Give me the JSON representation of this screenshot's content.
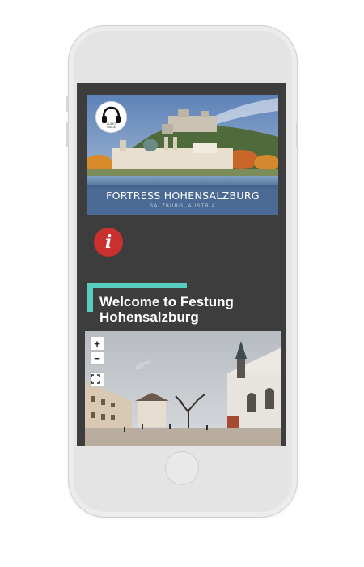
{
  "hero": {
    "title": "FORTRESS HOHENSALZBURG",
    "subtitle": "SALZBURG, AUSTRIA",
    "badge_label": "AUDIO\nGUIDE"
  },
  "welcome_heading": "Welcome to Festung Hohensalzburg",
  "viewer": {
    "zoom_in_label": "+",
    "zoom_out_label": "−",
    "watermark": "allmi"
  },
  "icons": {
    "info": "info-icon",
    "audio": "headphones-icon",
    "fullscreen": "fullscreen-icon"
  },
  "colors": {
    "screen_bg": "#3d3d3d",
    "accent": "#59ccc0",
    "info": "#c8312d",
    "hero_band": "#42628f"
  }
}
